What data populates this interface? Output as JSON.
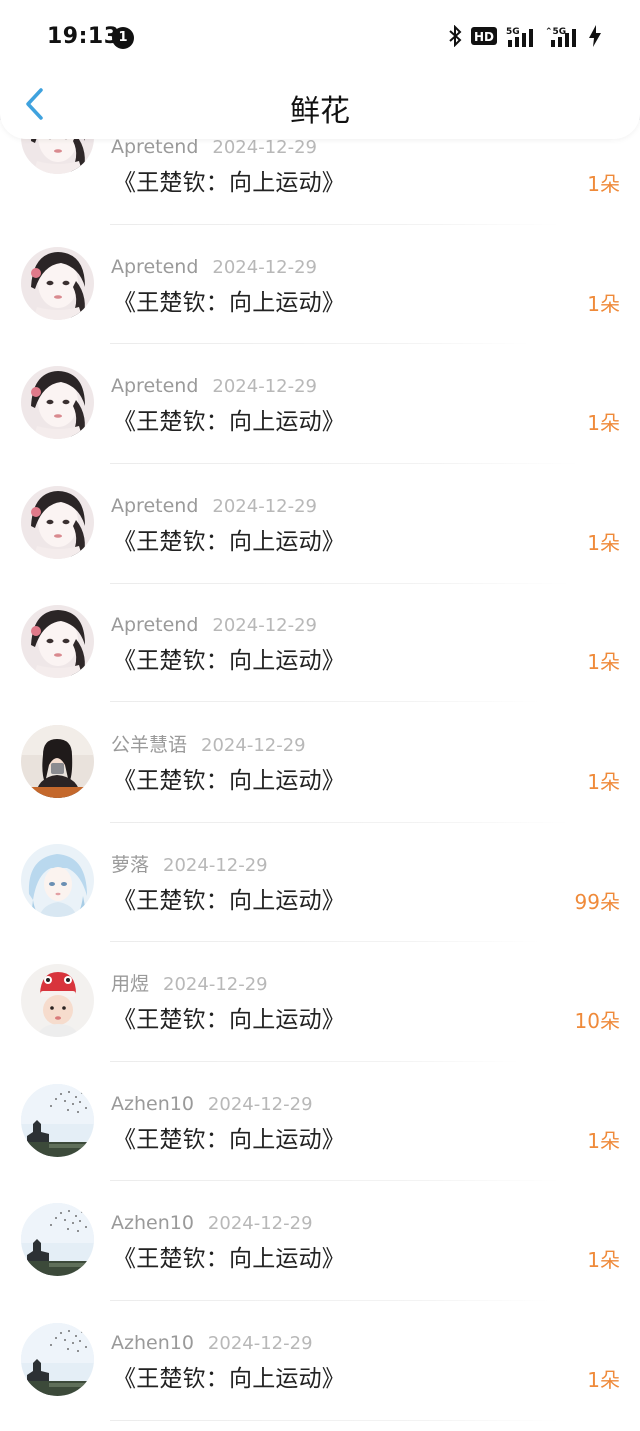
{
  "status_bar": {
    "time": "19:13",
    "notification_count": "1",
    "icons": [
      "bluetooth-icon",
      "hd-voice-icon",
      "signal-5g-icon",
      "signal-5g-icon",
      "charging-icon"
    ]
  },
  "nav": {
    "title": "鲜花",
    "back_icon": "chevron-left-icon"
  },
  "colors": {
    "accent": "#ef8a3a",
    "back": "#3fa2de",
    "username": "#9a9a9a",
    "date": "#b8b8b8"
  },
  "rows": [
    {
      "user": "Apretend",
      "date": "2024-12-29",
      "title": "《王楚钦：向上运动》",
      "count": "1朵",
      "avatar": "avatar-girl-pink"
    },
    {
      "user": "Apretend",
      "date": "2024-12-29",
      "title": "《王楚钦：向上运动》",
      "count": "1朵",
      "avatar": "avatar-girl-pink"
    },
    {
      "user": "Apretend",
      "date": "2024-12-29",
      "title": "《王楚钦：向上运动》",
      "count": "1朵",
      "avatar": "avatar-girl-pink"
    },
    {
      "user": "Apretend",
      "date": "2024-12-29",
      "title": "《王楚钦：向上运动》",
      "count": "1朵",
      "avatar": "avatar-girl-pink"
    },
    {
      "user": "Apretend",
      "date": "2024-12-29",
      "title": "《王楚钦：向上运动》",
      "count": "1朵",
      "avatar": "avatar-girl-pink"
    },
    {
      "user": "公羊慧语",
      "date": "2024-12-29",
      "title": "《王楚钦：向上运动》",
      "count": "1朵",
      "avatar": "avatar-girl-dark-hair"
    },
    {
      "user": "萝落",
      "date": "2024-12-29",
      "title": "《王楚钦：向上运动》",
      "count": "99朵",
      "avatar": "avatar-anime-blue"
    },
    {
      "user": "用煜",
      "date": "2024-12-29",
      "title": "《王楚钦：向上运动》",
      "count": "10朵",
      "avatar": "avatar-baby-red-hat"
    },
    {
      "user": "Azhen10",
      "date": "2024-12-29",
      "title": "《王楚钦：向上运动》",
      "count": "1朵",
      "avatar": "avatar-tower-birds"
    },
    {
      "user": "Azhen10",
      "date": "2024-12-29",
      "title": "《王楚钦：向上运动》",
      "count": "1朵",
      "avatar": "avatar-tower-birds"
    },
    {
      "user": "Azhen10",
      "date": "2024-12-29",
      "title": "《王楚钦：向上运动》",
      "count": "1朵",
      "avatar": "avatar-tower-birds"
    }
  ]
}
